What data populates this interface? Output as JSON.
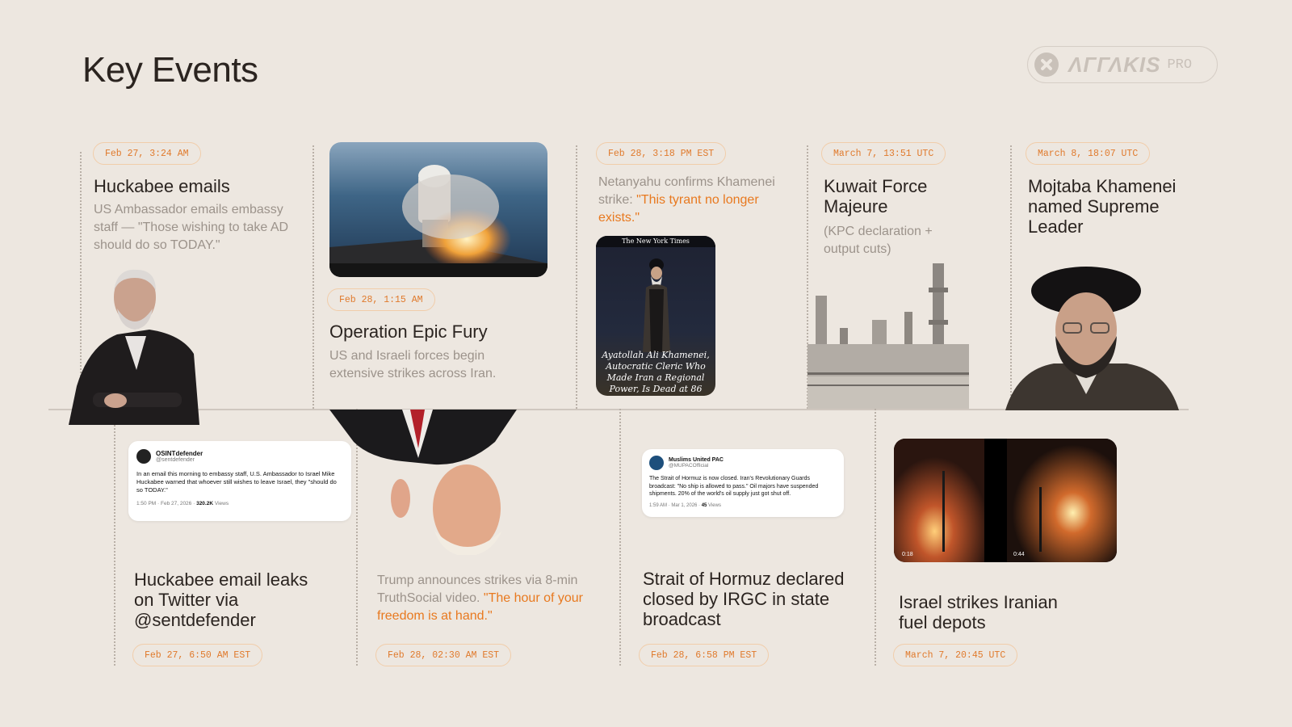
{
  "title": "Key Events",
  "brand": {
    "name": "ΛΓΓΛΚΙS",
    "tier": "PRO"
  },
  "top_events": [
    {
      "date": "Feb 27, 3:24 AM",
      "heading": "Huckabee emails",
      "text": "US Ambassador emails embassy staff — \"Those wishing to take AD should do so TODAY.\""
    },
    {
      "date": "Feb 28, 1:15 AM",
      "heading": "Operation Epic Fury",
      "text": "US and Israeli forces begin extensive strikes across Iran."
    },
    {
      "date": "Feb 28, 3:18 PM EST",
      "text_prefix": "Netanyahu confirms Khamenei strike: ",
      "text_quote": "\"This tyrant no longer exists.\"",
      "nyt": {
        "masthead": "The New York Times",
        "caption": "Ayatollah Ali Khamenei, Autocratic Cleric Who Made Iran a Regional Power, Is Dead at 86"
      }
    },
    {
      "date": "March 7, 13:51 UTC",
      "heading": "Kuwait Force Majeure",
      "text": "(KPC declaration + output cuts)"
    },
    {
      "date": "March 8, 18:07 UTC",
      "heading": "Mojtaba Khamenei named Supreme Leader"
    }
  ],
  "bottom_events": [
    {
      "date": "Feb 27, 6:50 AM EST",
      "heading": "Huckabee email leaks on Twitter via @sentdefender",
      "tweet": {
        "name": "OSINTdefender",
        "handle": "@sentdefender",
        "text": "In an email this morning to embassy staff, U.S. Ambassador to Israel Mike Huckabee warned that whoever still wishes to leave Israel, they \"should do so TODAY.\"",
        "meta": "1:50 PM · Feb 27, 2026 · ",
        "views": "320.2K",
        "views_label": " Views"
      }
    },
    {
      "date": "Feb 28, 02:30 AM EST",
      "text_prefix": "Trump announces strikes via 8-min TruthSocial video.  ",
      "text_quote": "\"The hour of your freedom is at hand.\""
    },
    {
      "date": "Feb 28, 6:58 PM EST",
      "heading": "Strait of Hormuz declared closed by IRGC in state broadcast",
      "tweet": {
        "name": "Muslims United PAC",
        "handle": "@MUPACOfficial",
        "text": "The Strait of Hormuz is now closed. Iran's Revolutionary Guards broadcast: \"No ship is allowed to pass.\" Oil majors have suspended shipments. 20% of the world's oil supply just got shut off.",
        "meta": "1:59 AM · Mar 1, 2026 · ",
        "views": "45",
        "views_label": " Views"
      }
    },
    {
      "date": "March 7, 20:45 UTC",
      "heading": "Israel strikes Iranian fuel depots",
      "video": {
        "t1": "0:18",
        "t2": "0:44"
      }
    }
  ],
  "colors": {
    "background": "#ede7e0",
    "accent": "#e8791f",
    "pill_border": "#f1cdaa",
    "heading": "#2b2420",
    "muted": "#9c938b"
  }
}
